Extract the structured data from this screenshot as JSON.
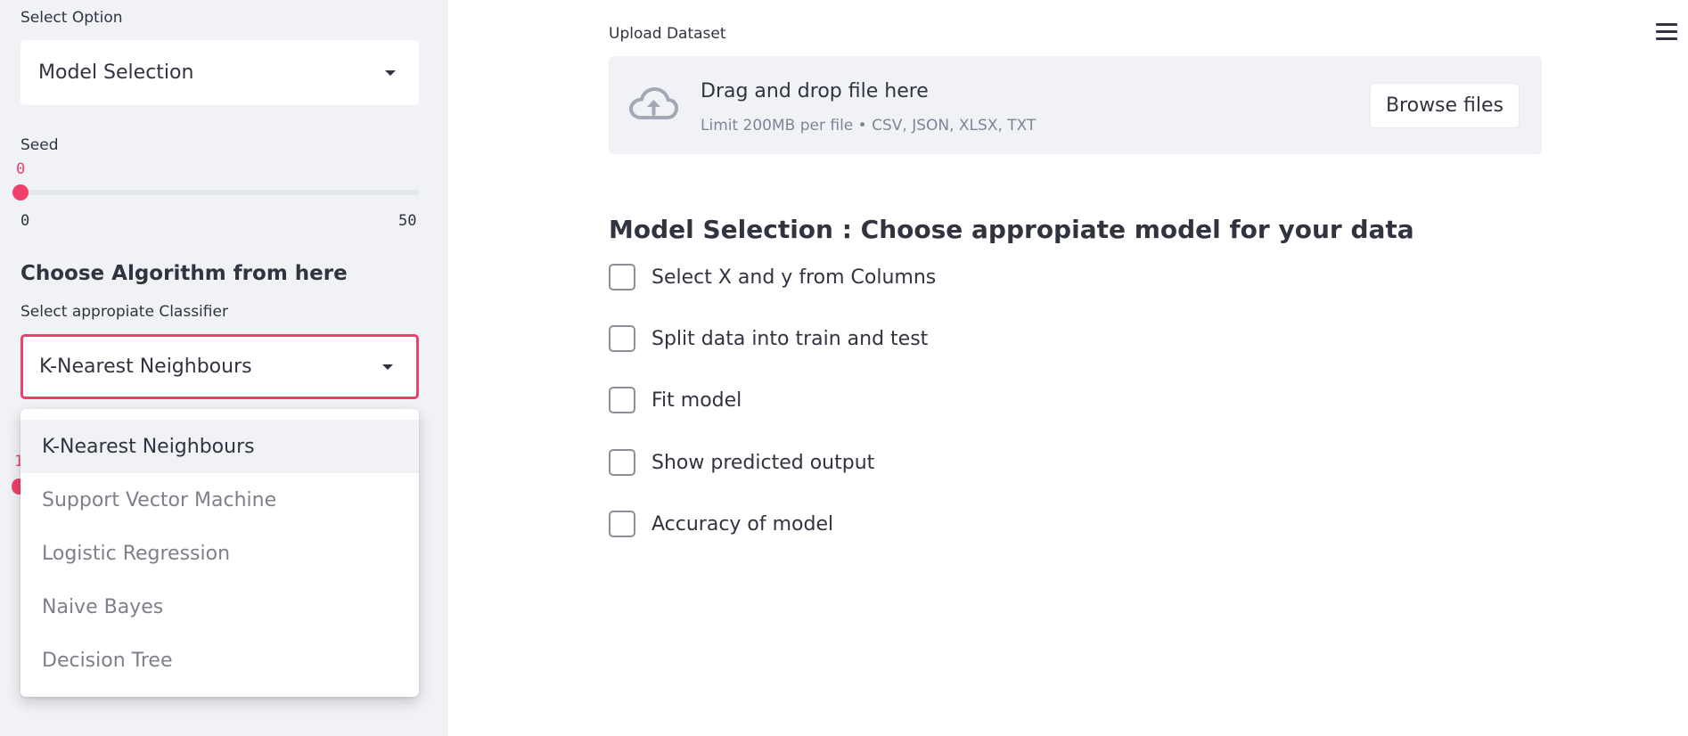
{
  "sidebar": {
    "option_label": "Select Option",
    "option_value": "Model Selection",
    "seed_label": "Seed",
    "seed_value": "0",
    "seed_min": "0",
    "seed_max": "50",
    "algo_title": "Choose Algorithm from here",
    "classifier_label": "Select appropiate Classifier",
    "classifier_value": "K-Nearest Neighbours",
    "hidden_value_fragment": "1",
    "classifier_options": [
      "K-Nearest Neighbours",
      "Support Vector Machine",
      "Logistic Regression",
      "Naive Bayes",
      "Decision Tree"
    ]
  },
  "main": {
    "upload_label": "Upload Dataset",
    "drag_text": "Drag and drop file here",
    "limit_text": "Limit 200MB per file • CSV, JSON, XLSX, TXT",
    "browse_label": "Browse files",
    "heading": "Model Selection : Choose appropiate model for your data",
    "checkboxes": [
      "Select X and y from Columns",
      "Split data into train and test",
      "Fit model",
      "Show predicted output",
      "Accuracy of model"
    ]
  },
  "colors": {
    "accent": "#f0406a",
    "sidebar_bg": "#f0f2f6",
    "text": "#31333f",
    "muted_text": "#808495"
  },
  "icons": {
    "upload": "cloud-upload-icon",
    "menu": "hamburger-menu-icon",
    "dropdown": "chevron-down-icon"
  }
}
